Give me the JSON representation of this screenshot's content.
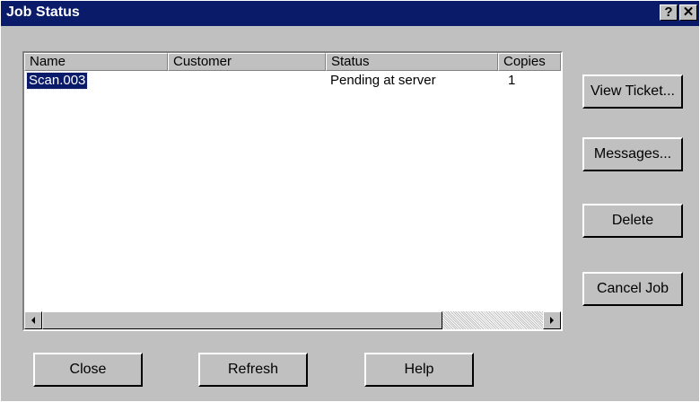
{
  "window": {
    "title": "Job Status",
    "help_glyph": "?",
    "close_glyph": "✕"
  },
  "list": {
    "columns": [
      "Name",
      "Customer",
      "Status",
      "Copies"
    ],
    "rows": [
      {
        "name": "Scan.003",
        "customer": "",
        "status": "Pending at server",
        "copies": "1"
      }
    ]
  },
  "side_buttons": {
    "view_ticket": "View Ticket...",
    "messages": "Messages...",
    "delete": "Delete",
    "cancel_job": "Cancel Job"
  },
  "bottom_buttons": {
    "close": "Close",
    "refresh": "Refresh",
    "help": "Help"
  },
  "colors": {
    "titlebar": "#0a1b6a",
    "face": "#c0c0c0",
    "selection": "#0a1b6a"
  }
}
